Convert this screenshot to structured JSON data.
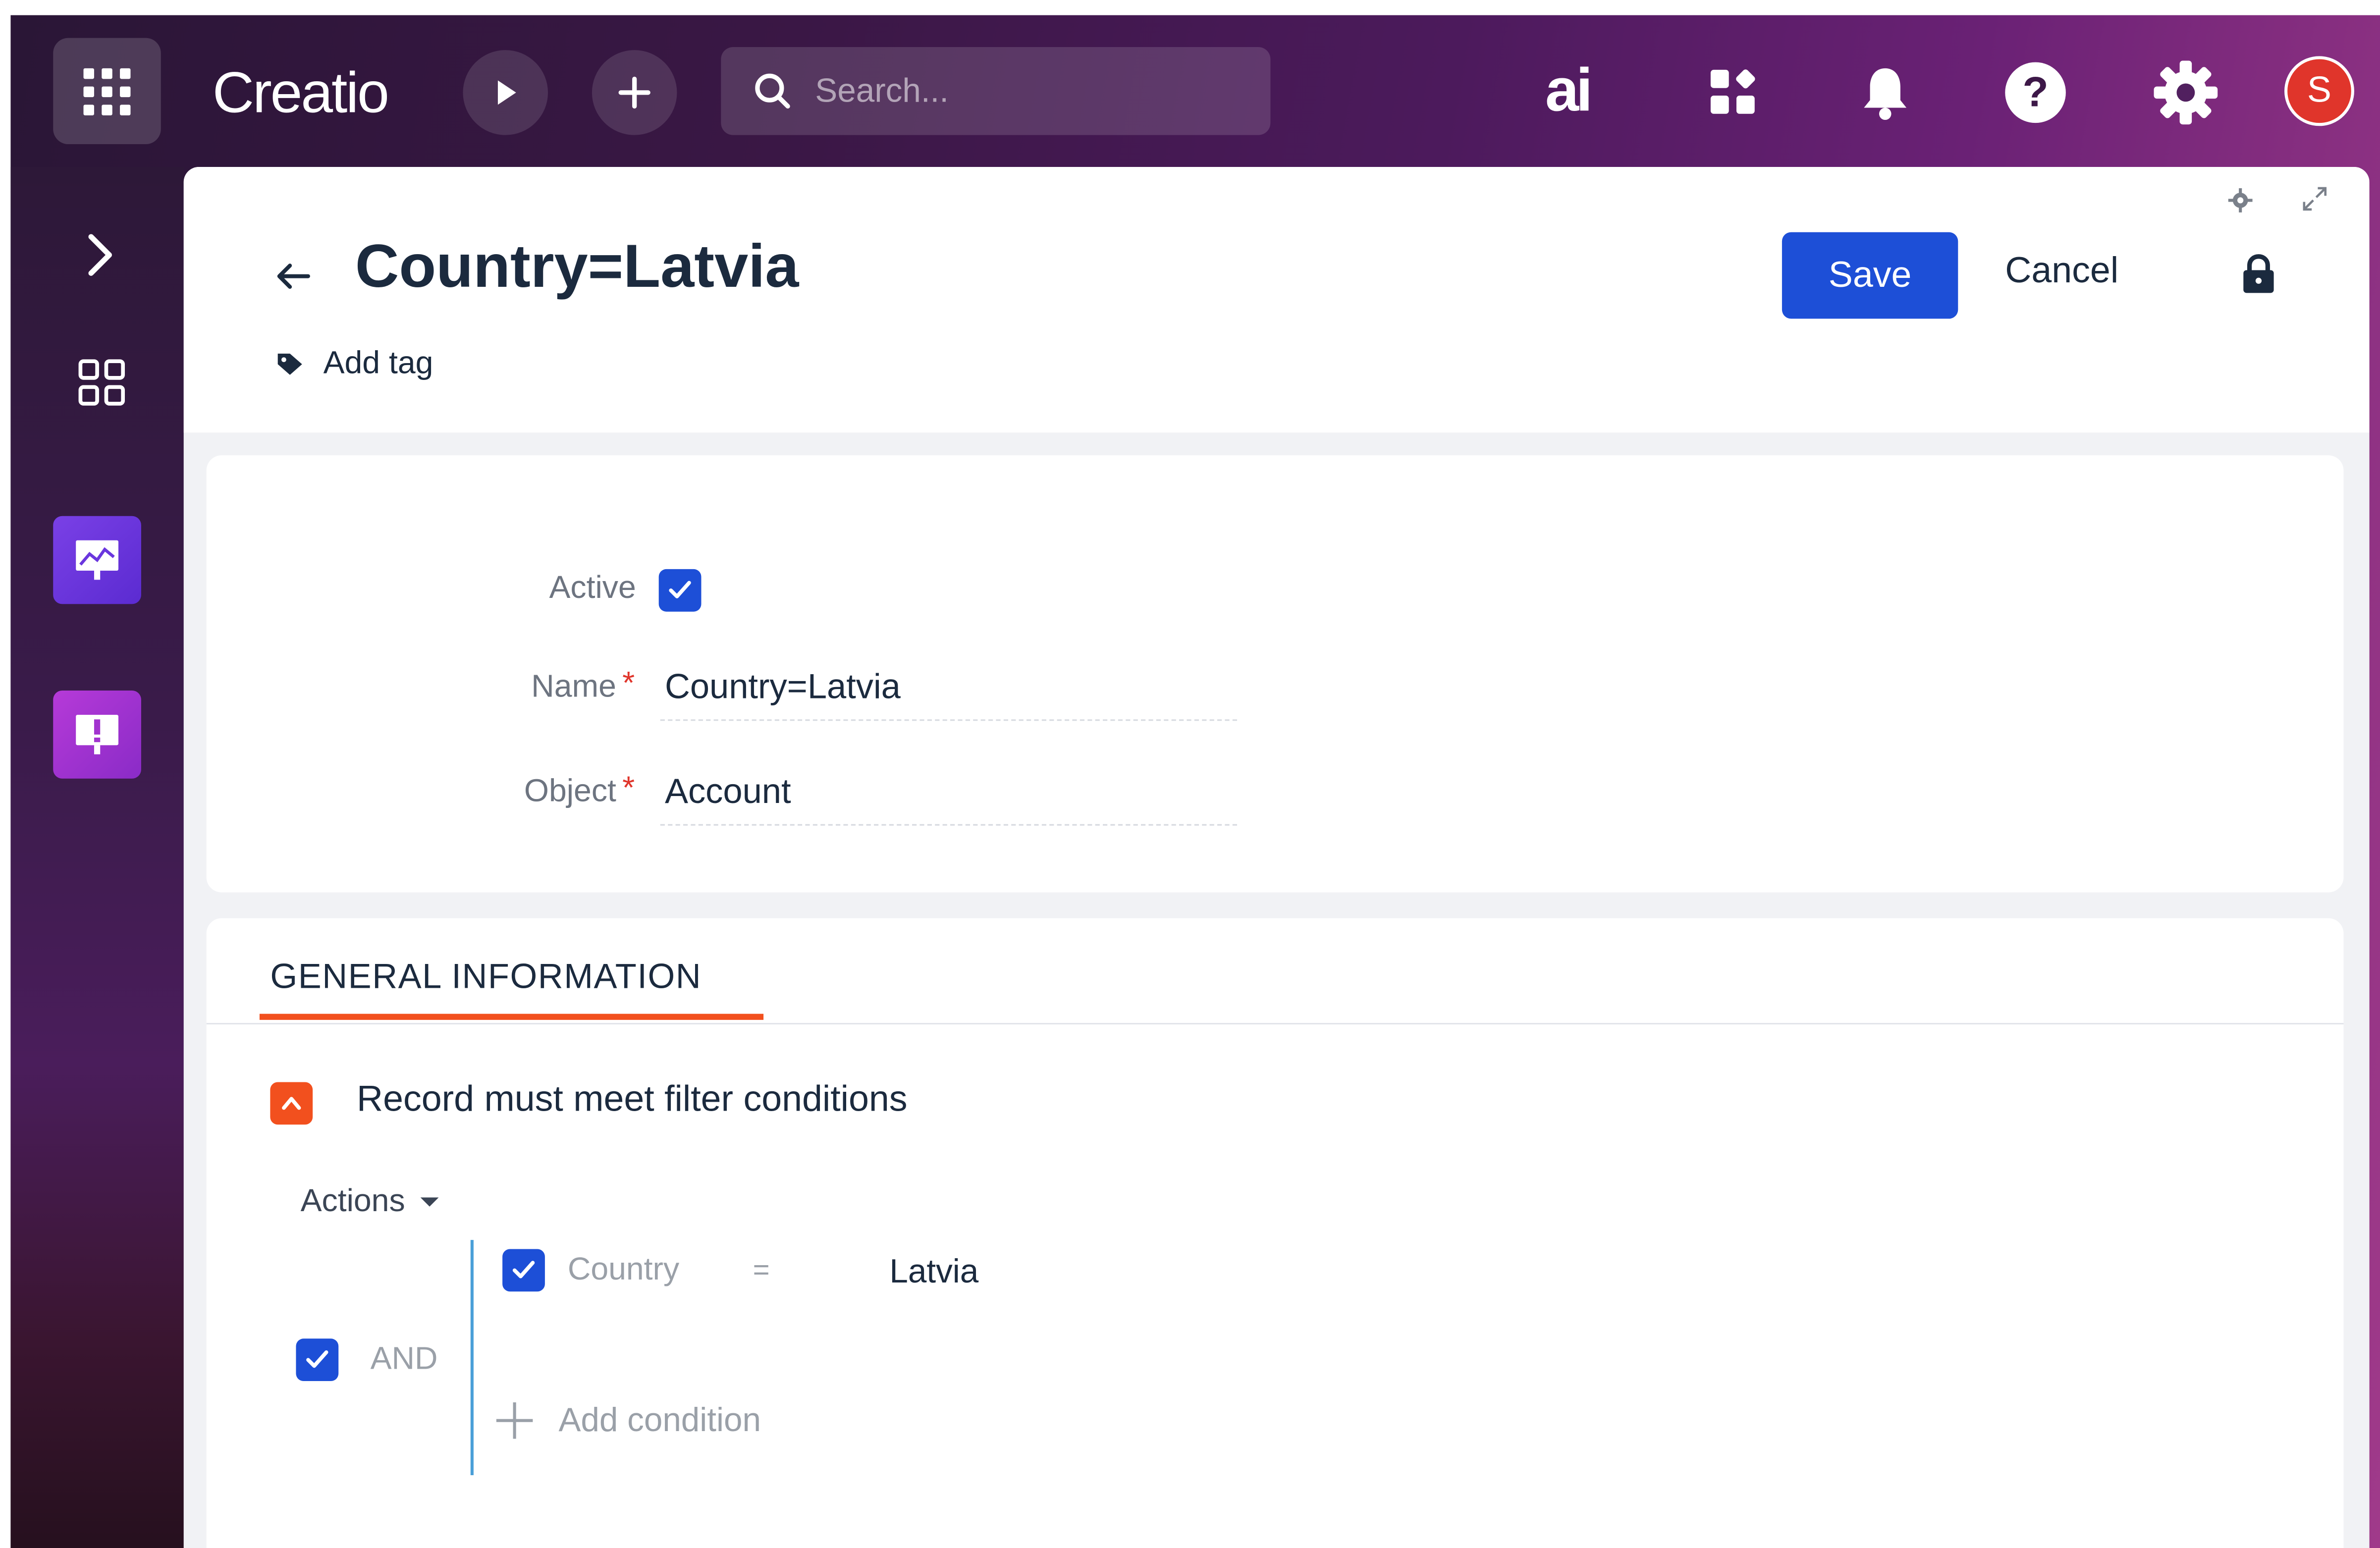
{
  "topbar": {
    "logo": "Creatio",
    "search_placeholder": "Search...",
    "ai_label": "ai",
    "avatar_initial": "S"
  },
  "record": {
    "title": "Country=Latvia",
    "add_tag_label": "Add tag",
    "save_label": "Save",
    "cancel_label": "Cancel"
  },
  "fields": {
    "active_label": "Active",
    "active_checked": true,
    "name_label": "Name",
    "name_value": "Country=Latvia",
    "object_label": "Object",
    "object_value": "Account",
    "required_mark": "*"
  },
  "general": {
    "tab_label": "GENERAL INFORMATION",
    "group_title": "Record must meet filter conditions",
    "actions_label": "Actions",
    "logic_label": "AND",
    "conditions": [
      {
        "field": "Country",
        "operator": "=",
        "value": "Latvia"
      }
    ],
    "add_condition_label": "Add condition"
  },
  "colors": {
    "accent": "#1d4fd7",
    "orange": "#f2501e",
    "title": "#1b2a3e"
  }
}
